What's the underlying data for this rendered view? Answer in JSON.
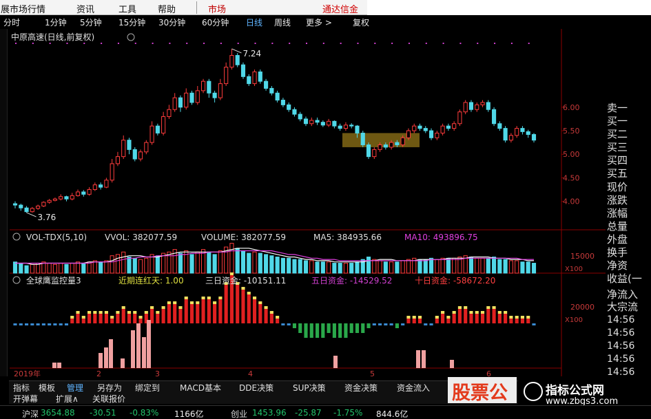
{
  "menu": {
    "items": [
      "展市场行情",
      "资讯",
      "工具",
      "帮助"
    ],
    "market": "市场",
    "broker": "通达信金"
  },
  "periods": [
    "分时",
    "1分钟",
    "5分钟",
    "15分钟",
    "30分钟",
    "60分钟",
    "日线",
    "周线",
    "更多 >",
    "复权"
  ],
  "active_period": "日线",
  "main_chart": {
    "title": "中原高速(日线,前复权)",
    "max_label": "7.24",
    "min_label": "3.76",
    "y_ticks": [
      "6.00",
      "5.50",
      "5.00",
      "4.50",
      "4.00"
    ],
    "x_labels": [
      "2019年",
      "2",
      "3",
      "4",
      "5",
      "6"
    ]
  },
  "volume": {
    "header": "VOL-TDX(5,10)",
    "vvol": "VVOL: 382077.59",
    "volume": "VOLUME: 382077.59",
    "ma5": "MA5: 384935.66",
    "ma10": "MA10: 493896.75",
    "y_tick": "15000",
    "unit": "X100"
  },
  "monitor": {
    "header": "全球鹰监控量3",
    "streak": "近期连红天: 1.00",
    "fund3": "三日资金: -10151.11",
    "fund5": "五日资金: -14529.52",
    "fund10": "十日资金: -58672.20",
    "y_tick": "20000",
    "unit": "X100"
  },
  "side_panel": {
    "labels": [
      "卖一",
      "买一",
      "买二",
      "买三",
      "买四",
      "买五",
      "现价",
      "涨跌",
      "涨幅",
      "总量",
      "外盘",
      "换手",
      "净资",
      "收益(一",
      "净流入",
      "大宗流"
    ],
    "times": [
      "14:56",
      "14:56",
      "14:56",
      "14:56",
      "14:56"
    ]
  },
  "tabs_row1": [
    "指标",
    "模板",
    "管理",
    "另存为",
    "绑定到",
    "MACD基本",
    "DDE决策",
    "SUP决策",
    "资金决策",
    "资金流入"
  ],
  "active_tab": "管理",
  "tabs_row2": [
    "开弹幕",
    "扩展∧",
    "关联报价"
  ],
  "status": {
    "index_name": "沪深",
    "index_value": "3654.88",
    "index_change": "-30.51",
    "index_pct": "-0.83%",
    "index_amount": "1166亿",
    "gem_name": "创业",
    "gem_value": "1453.96",
    "gem_change": "-25.87",
    "gem_pct": "-1.75%",
    "gem_amount": "844.6亿"
  },
  "watermark": {
    "left": "股票公",
    "right_title": "指标公式网",
    "right_url": "www.zbgs3.com"
  },
  "colors": {
    "up": "#ff3c3c",
    "down": "#50d8e8",
    "ma5": "#ffffff",
    "ma10": "#e040e0",
    "grid_red": "#8b0000",
    "highlight": "#c8a020"
  },
  "chart_data": {
    "type": "candlestick",
    "price_range": [
      3.76,
      7.24
    ],
    "candles": [
      [
        3.95,
        3.92,
        4.0,
        3.85
      ],
      [
        3.92,
        3.86,
        3.95,
        3.8
      ],
      [
        3.86,
        3.78,
        3.9,
        3.76
      ],
      [
        3.78,
        3.85,
        3.88,
        3.76
      ],
      [
        3.85,
        3.9,
        3.93,
        3.82
      ],
      [
        3.9,
        3.98,
        4.0,
        3.88
      ],
      [
        3.98,
        4.02,
        4.05,
        3.95
      ],
      [
        4.02,
        4.05,
        4.08,
        4.0
      ],
      [
        4.05,
        4.1,
        4.15,
        4.02
      ],
      [
        4.1,
        4.05,
        4.12,
        4.0
      ],
      [
        4.05,
        4.12,
        4.18,
        4.02
      ],
      [
        4.12,
        4.2,
        4.25,
        4.1
      ],
      [
        4.2,
        4.15,
        4.24,
        4.1
      ],
      [
        4.15,
        4.25,
        4.3,
        4.12
      ],
      [
        4.25,
        4.35,
        4.4,
        4.22
      ],
      [
        4.35,
        4.3,
        4.4,
        4.25
      ],
      [
        4.3,
        4.45,
        4.5,
        4.28
      ],
      [
        4.45,
        4.8,
        4.9,
        4.4
      ],
      [
        4.8,
        4.95,
        5.05,
        4.75
      ],
      [
        4.95,
        5.3,
        5.4,
        4.9
      ],
      [
        5.3,
        5.1,
        5.35,
        5.0
      ],
      [
        5.1,
        4.9,
        5.15,
        4.85
      ],
      [
        4.9,
        5.05,
        5.1,
        4.85
      ],
      [
        5.05,
        5.25,
        5.3,
        5.0
      ],
      [
        5.25,
        5.6,
        5.7,
        5.2
      ],
      [
        5.6,
        5.45,
        5.65,
        5.4
      ],
      [
        5.45,
        5.8,
        5.9,
        5.4
      ],
      [
        5.8,
        5.95,
        6.05,
        5.75
      ],
      [
        5.95,
        6.2,
        6.3,
        5.9
      ],
      [
        6.2,
        6.0,
        6.25,
        5.9
      ],
      [
        6.0,
        6.3,
        6.4,
        5.95
      ],
      [
        6.3,
        6.1,
        6.35,
        6.05
      ],
      [
        6.1,
        6.35,
        6.45,
        6.05
      ],
      [
        6.35,
        6.55,
        6.6,
        6.3
      ],
      [
        6.55,
        6.3,
        6.6,
        6.2
      ],
      [
        6.3,
        6.2,
        6.35,
        6.1
      ],
      [
        6.2,
        6.5,
        6.6,
        6.15
      ],
      [
        6.5,
        6.85,
        6.95,
        6.45
      ],
      [
        6.85,
        7.1,
        7.24,
        6.8
      ],
      [
        7.1,
        6.9,
        7.15,
        6.85
      ],
      [
        6.9,
        6.65,
        6.95,
        6.6
      ],
      [
        6.65,
        6.5,
        6.7,
        6.45
      ],
      [
        6.5,
        6.75,
        6.8,
        6.45
      ],
      [
        6.75,
        6.55,
        6.8,
        6.5
      ],
      [
        6.55,
        6.4,
        6.6,
        6.35
      ],
      [
        6.4,
        6.3,
        6.45,
        6.25
      ],
      [
        6.3,
        6.15,
        6.35,
        6.1
      ],
      [
        6.15,
        6.05,
        6.2,
        6.0
      ],
      [
        6.05,
        5.95,
        6.1,
        5.9
      ],
      [
        5.95,
        5.85,
        6.0,
        5.8
      ],
      [
        5.85,
        5.75,
        5.9,
        5.7
      ],
      [
        5.75,
        5.65,
        5.8,
        5.6
      ],
      [
        5.65,
        5.72,
        5.78,
        5.6
      ],
      [
        5.72,
        5.68,
        5.78,
        5.62
      ],
      [
        5.68,
        5.62,
        5.72,
        5.58
      ],
      [
        5.62,
        5.7,
        5.75,
        5.58
      ],
      [
        5.7,
        5.6,
        5.72,
        5.55
      ],
      [
        5.6,
        5.55,
        5.65,
        5.5
      ],
      [
        5.55,
        5.62,
        5.68,
        5.5
      ],
      [
        5.62,
        5.6,
        5.66,
        5.55
      ],
      [
        5.6,
        5.45,
        5.62,
        5.35
      ],
      [
        5.45,
        5.2,
        5.5,
        5.15
      ],
      [
        5.2,
        4.95,
        5.25,
        4.9
      ],
      [
        4.95,
        5.1,
        5.15,
        4.9
      ],
      [
        5.1,
        5.2,
        5.25,
        5.05
      ],
      [
        5.2,
        5.15,
        5.25,
        5.1
      ],
      [
        5.15,
        5.25,
        5.3,
        5.1
      ],
      [
        5.25,
        5.2,
        5.3,
        5.15
      ],
      [
        5.2,
        5.35,
        5.4,
        5.15
      ],
      [
        5.35,
        5.5,
        5.55,
        5.3
      ],
      [
        5.5,
        5.6,
        5.65,
        5.45
      ],
      [
        5.6,
        5.55,
        5.65,
        5.5
      ],
      [
        5.55,
        5.5,
        5.6,
        5.45
      ],
      [
        5.5,
        5.35,
        5.55,
        5.3
      ],
      [
        5.35,
        5.45,
        5.5,
        5.3
      ],
      [
        5.45,
        5.6,
        5.65,
        5.4
      ],
      [
        5.6,
        5.55,
        5.65,
        5.5
      ],
      [
        5.55,
        5.65,
        5.7,
        5.5
      ],
      [
        5.65,
        5.9,
        5.95,
        5.6
      ],
      [
        5.9,
        6.1,
        6.15,
        5.85
      ],
      [
        6.1,
        5.95,
        6.15,
        5.9
      ],
      [
        5.95,
        6.05,
        6.1,
        5.9
      ],
      [
        6.05,
        6.1,
        6.15,
        6.0
      ],
      [
        6.1,
        5.95,
        6.15,
        5.9
      ],
      [
        5.95,
        5.65,
        6.0,
        5.6
      ],
      [
        5.65,
        5.55,
        5.7,
        5.5
      ],
      [
        5.55,
        5.3,
        5.6,
        5.25
      ],
      [
        5.3,
        5.4,
        5.45,
        5.25
      ],
      [
        5.4,
        5.55,
        5.6,
        5.35
      ],
      [
        5.55,
        5.48,
        5.6,
        5.42
      ],
      [
        5.48,
        5.42,
        5.52,
        5.35
      ],
      [
        5.42,
        5.3,
        5.45,
        5.25
      ]
    ],
    "volume": [
      9,
      8,
      6,
      7,
      8,
      9,
      8,
      7,
      8,
      7,
      8,
      9,
      8,
      9,
      10,
      9,
      10,
      14,
      15,
      17,
      13,
      12,
      11,
      12,
      15,
      14,
      16,
      17,
      19,
      16,
      18,
      15,
      17,
      19,
      17,
      15,
      18,
      21,
      24,
      20,
      18,
      16,
      17,
      16,
      15,
      14,
      13,
      12,
      12,
      11,
      11,
      10,
      10,
      9,
      9,
      9,
      8,
      8,
      8,
      8,
      9,
      11,
      13,
      11,
      10,
      9,
      9,
      9,
      10,
      11,
      12,
      11,
      11,
      12,
      11,
      12,
      12,
      12,
      13,
      14,
      13,
      12,
      12,
      12,
      13,
      11,
      11,
      10,
      10,
      9,
      9,
      8
    ],
    "ma5": [
      8,
      8,
      8,
      7,
      7,
      8,
      8,
      8,
      8,
      8,
      8,
      8,
      8,
      9,
      9,
      9,
      9,
      10,
      12,
      13,
      14,
      14,
      14,
      13,
      13,
      13,
      14,
      15,
      16,
      17,
      17,
      17,
      17,
      17,
      17,
      17,
      17,
      18,
      19,
      20,
      20,
      20,
      19,
      18,
      17,
      16,
      15,
      14,
      13,
      13,
      12,
      11,
      11,
      10,
      10,
      10,
      9,
      9,
      9,
      9,
      9,
      9,
      10,
      10,
      11,
      11,
      11,
      10,
      10,
      10,
      10,
      11,
      11,
      11,
      11,
      11,
      12,
      12,
      12,
      12,
      13,
      13,
      13,
      13,
      12,
      12,
      12,
      11,
      11,
      11,
      10,
      10
    ],
    "ma10": [
      8,
      8,
      8,
      8,
      8,
      8,
      8,
      8,
      8,
      8,
      8,
      8,
      8,
      8,
      9,
      9,
      9,
      9,
      10,
      11,
      12,
      12,
      13,
      13,
      13,
      14,
      14,
      14,
      14,
      15,
      15,
      16,
      16,
      16,
      17,
      17,
      17,
      17,
      18,
      18,
      18,
      18,
      18,
      18,
      18,
      18,
      17,
      16,
      15,
      15,
      14,
      13,
      12,
      12,
      11,
      11,
      11,
      10,
      10,
      10,
      10,
      10,
      10,
      10,
      10,
      10,
      10,
      10,
      10,
      10,
      10,
      10,
      10,
      11,
      11,
      11,
      11,
      11,
      11,
      12,
      12,
      12,
      12,
      12,
      12,
      12,
      12,
      12,
      12,
      11,
      11,
      11
    ],
    "monitor": [
      0,
      0,
      0,
      0,
      0,
      0,
      0,
      0,
      0,
      0,
      1,
      2,
      1,
      2,
      2,
      2,
      2,
      1,
      2,
      3,
      2,
      2,
      1,
      2,
      3,
      2,
      3,
      4,
      4,
      3,
      5,
      4,
      4,
      5,
      5,
      4,
      5,
      8,
      10,
      8,
      7,
      6,
      5,
      4,
      3,
      2,
      1,
      0,
      0,
      -1,
      -2,
      -3,
      -3,
      -3,
      -3,
      -2,
      -3,
      -3,
      -3,
      -2,
      -2,
      -2,
      -1,
      0,
      0,
      0,
      0,
      -1,
      0,
      1,
      1,
      1,
      0,
      0,
      1,
      2,
      1,
      2,
      3,
      3,
      2,
      2,
      2,
      3,
      3,
      2,
      2,
      1,
      1,
      1,
      1,
      0
    ]
  }
}
